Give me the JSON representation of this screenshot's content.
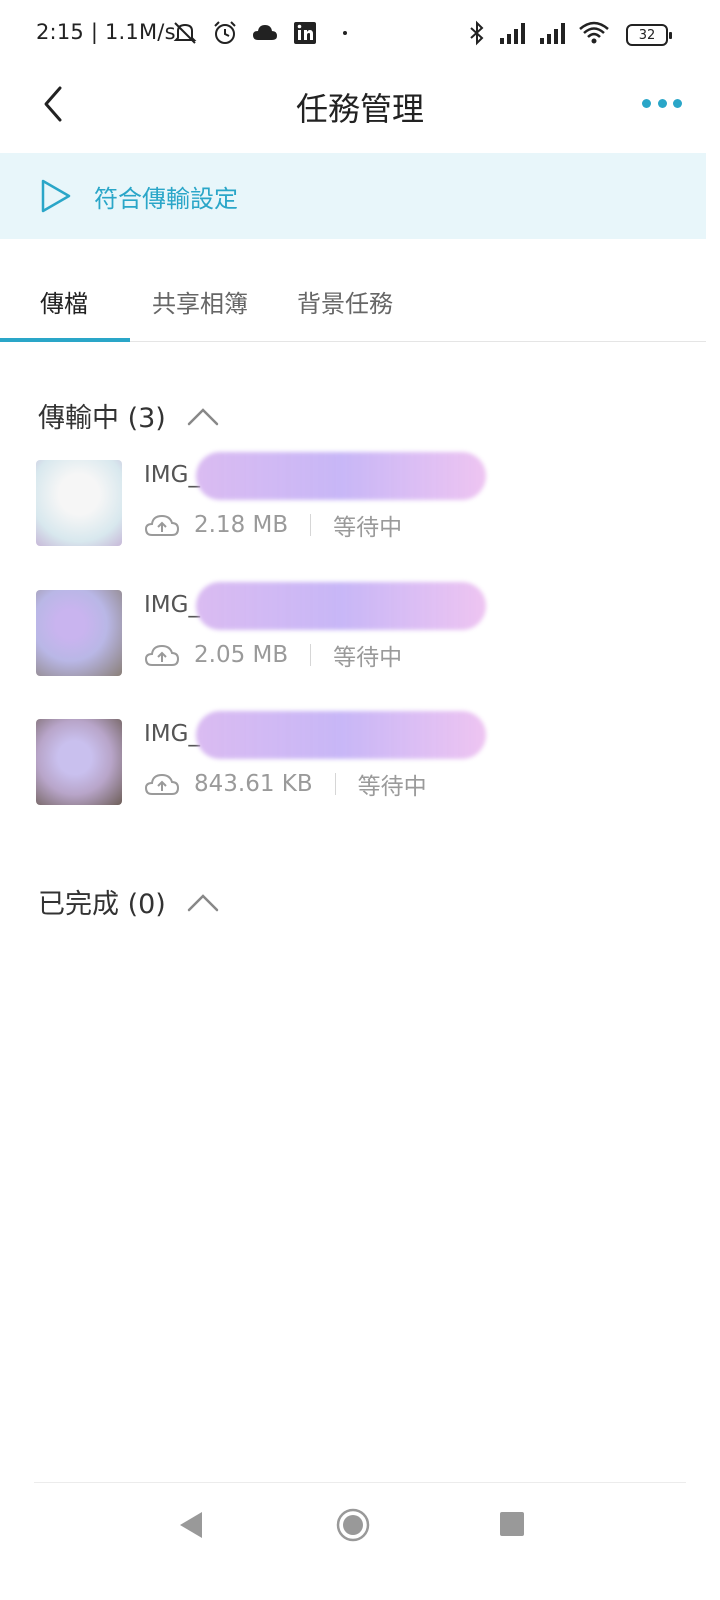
{
  "status_bar": {
    "time_speed": "2:15 | 1.1M/s",
    "battery": "32",
    "icons_left": [
      "mute-icon",
      "alarm-icon",
      "cloud-icon",
      "linkedin-icon",
      "dot-icon"
    ],
    "icons_right": [
      "bluetooth-icon",
      "signal-icon",
      "signal-icon",
      "wifi-icon"
    ]
  },
  "header": {
    "title": "任務管理"
  },
  "banner": {
    "label": "符合傳輸設定"
  },
  "tabs": [
    {
      "label": "傳檔",
      "active": true
    },
    {
      "label": "共享相簿",
      "active": false
    },
    {
      "label": "背景任務",
      "active": false
    }
  ],
  "in_progress": {
    "title": "傳輸中 (3)",
    "items": [
      {
        "name": "IMG_",
        "size": "2.18 MB",
        "status": "等待中"
      },
      {
        "name": "IMG_",
        "size": "2.05 MB",
        "status": "等待中"
      },
      {
        "name": "IMG_",
        "size": "843.61 KB",
        "status": "等待中"
      }
    ]
  },
  "completed": {
    "title": "已完成 (0)"
  },
  "colors": {
    "accent": "#2aa6c8",
    "banner_bg": "#e8f6fa"
  }
}
